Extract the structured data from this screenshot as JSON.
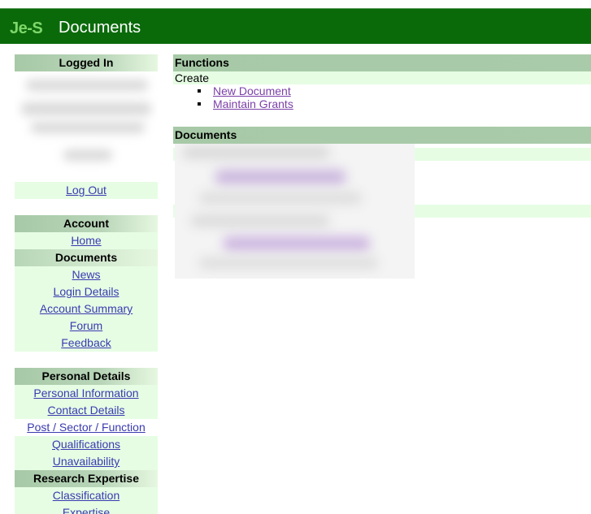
{
  "header": {
    "logo": "Je-S",
    "title": "Documents"
  },
  "sidebar": {
    "logged_in": {
      "heading": "Logged In",
      "logout_label": "Log Out"
    },
    "account": {
      "heading": "Account",
      "items": [
        "Home",
        "Documents",
        "News",
        "Login Details",
        "Account Summary",
        "Forum",
        "Feedback"
      ],
      "current": "Documents"
    },
    "personal_details": {
      "heading": "Personal Details",
      "items": [
        "Personal Information",
        "Contact Details",
        "Post / Sector / Function",
        "Qualifications",
        "Unavailability"
      ]
    },
    "research_expertise": {
      "heading": "Research Expertise",
      "items": [
        "Classification",
        "Expertise"
      ]
    }
  },
  "main": {
    "functions": {
      "heading": "Functions",
      "create_label": "Create",
      "links": [
        "New Document",
        "Maintain Grants"
      ]
    },
    "documents": {
      "heading": "Documents"
    }
  },
  "colors": {
    "header_bg": "#0a6a0a",
    "logo": "#7fd76a",
    "section_head": "#a7c9a7",
    "row_tint": "#e6fde4",
    "link": "#3a3ab0",
    "visited_link": "#7b3fa8"
  }
}
